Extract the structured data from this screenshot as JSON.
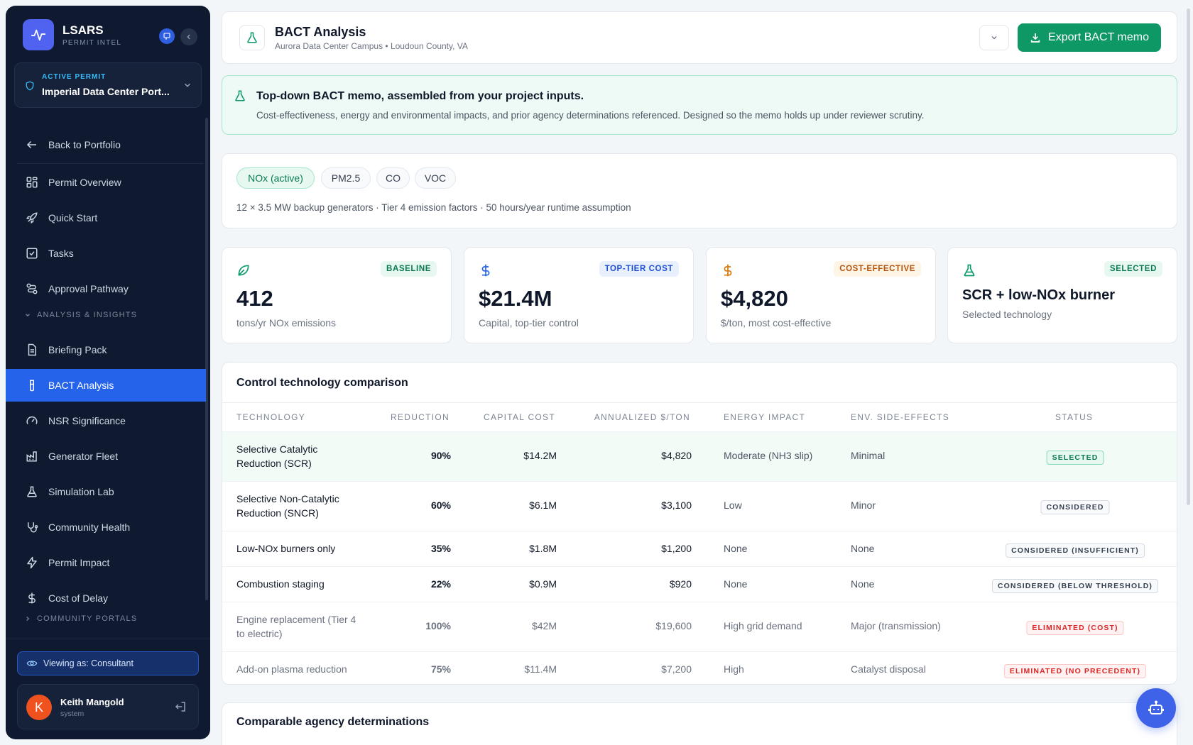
{
  "brand": {
    "name": "LSARS",
    "subtitle": "PERMIT INTEL"
  },
  "active_permit": {
    "label": "ACTIVE PERMIT",
    "value": "Imperial Data Center Port..."
  },
  "nav": {
    "back": "Back to Portfolio",
    "items_top": [
      "Permit Overview",
      "Quick Start",
      "Tasks",
      "Approval Pathway"
    ],
    "section_analysis": "ANALYSIS & INSIGHTS",
    "items_analysis": [
      "Briefing Pack",
      "BACT Analysis",
      "NSR Significance",
      "Generator Fleet",
      "Simulation Lab",
      "Community Health",
      "Permit Impact",
      "Cost of Delay"
    ],
    "section_community": "COMMUNITY PORTALS"
  },
  "viewing_as": "Viewing as: Consultant",
  "user": {
    "initial": "K",
    "name": "Keith Mangold",
    "role": "system"
  },
  "header": {
    "title": "BACT Analysis",
    "subtitle": "Aurora Data Center Campus • Loudoun County, VA",
    "export_label": "Export BACT memo"
  },
  "banner": {
    "title": "Top-down BACT memo, assembled from your project inputs.",
    "description": "Cost-effectiveness, energy and environmental impacts, and prior agency determinations referenced. Designed so the memo holds up under reviewer scrutiny."
  },
  "pollutants": {
    "pills": [
      "NOx (active)",
      "PM2.5",
      "CO",
      "VOC"
    ],
    "description": "12 × 3.5 MW backup generators · Tier 4 emission factors · 50 hours/year runtime assumption"
  },
  "stats": [
    {
      "badge": "BASELINE",
      "value": "412",
      "label": "tons/yr NOx emissions",
      "icon": "leaf-icon",
      "color": "#0b9a6a"
    },
    {
      "badge": "TOP-TIER COST",
      "value": "$21.4M",
      "label": "Capital, top-tier control",
      "icon": "dollar-icon",
      "color": "#2563eb"
    },
    {
      "badge": "COST-EFFECTIVE",
      "value": "$4,820",
      "label": "$/ton, most cost-effective",
      "icon": "dollar-icon",
      "color": "#d97706"
    },
    {
      "badge": "SELECTED",
      "value": "SCR + low-NOx burner",
      "label": "Selected technology",
      "icon": "flask-icon",
      "color": "#0b9a6a"
    }
  ],
  "table": {
    "title": "Control technology comparison",
    "headers": [
      "TECHNOLOGY",
      "REDUCTION",
      "CAPITAL COST",
      "ANNUALIZED $/TON",
      "ENERGY IMPACT",
      "ENV. SIDE-EFFECTS",
      "STATUS"
    ],
    "rows": [
      {
        "tech1": "Selective Catalytic",
        "tech2": "Reduction (SCR)",
        "reduction": "90%",
        "capital": "$14.2M",
        "annualized": "$4,820",
        "energy": "Moderate (NH3 slip)",
        "env": "Minimal",
        "status": "SELECTED",
        "kind": "selected"
      },
      {
        "tech1": "Selective Non-Catalytic",
        "tech2": "Reduction (SNCR)",
        "reduction": "60%",
        "capital": "$6.1M",
        "annualized": "$3,100",
        "energy": "Low",
        "env": "Minor",
        "status": "CONSIDERED",
        "kind": "considered"
      },
      {
        "tech1": "Low-NOx burners only",
        "tech2": "",
        "reduction": "35%",
        "capital": "$1.8M",
        "annualized": "$1,200",
        "energy": "None",
        "env": "None",
        "status": "CONSIDERED (INSUFFICIENT)",
        "kind": "considered"
      },
      {
        "tech1": "Combustion staging",
        "tech2": "",
        "reduction": "22%",
        "capital": "$0.9M",
        "annualized": "$920",
        "energy": "None",
        "env": "None",
        "status": "CONSIDERED (BELOW THRESHOLD)",
        "kind": "considered"
      },
      {
        "tech1": "Engine replacement (Tier 4",
        "tech2": "to electric)",
        "reduction": "100%",
        "capital": "$42M",
        "annualized": "$19,600",
        "energy": "High grid demand",
        "env": "Major (transmission)",
        "status": "ELIMINATED (COST)",
        "kind": "eliminated"
      },
      {
        "tech1": "Add-on plasma reduction",
        "tech2": "",
        "reduction": "75%",
        "capital": "$11.4M",
        "annualized": "$7,200",
        "energy": "High",
        "env": "Catalyst disposal",
        "status": "ELIMINATED (NO PRECEDENT)",
        "kind": "eliminated"
      }
    ]
  },
  "comparable": {
    "title": "Comparable agency determinations"
  }
}
